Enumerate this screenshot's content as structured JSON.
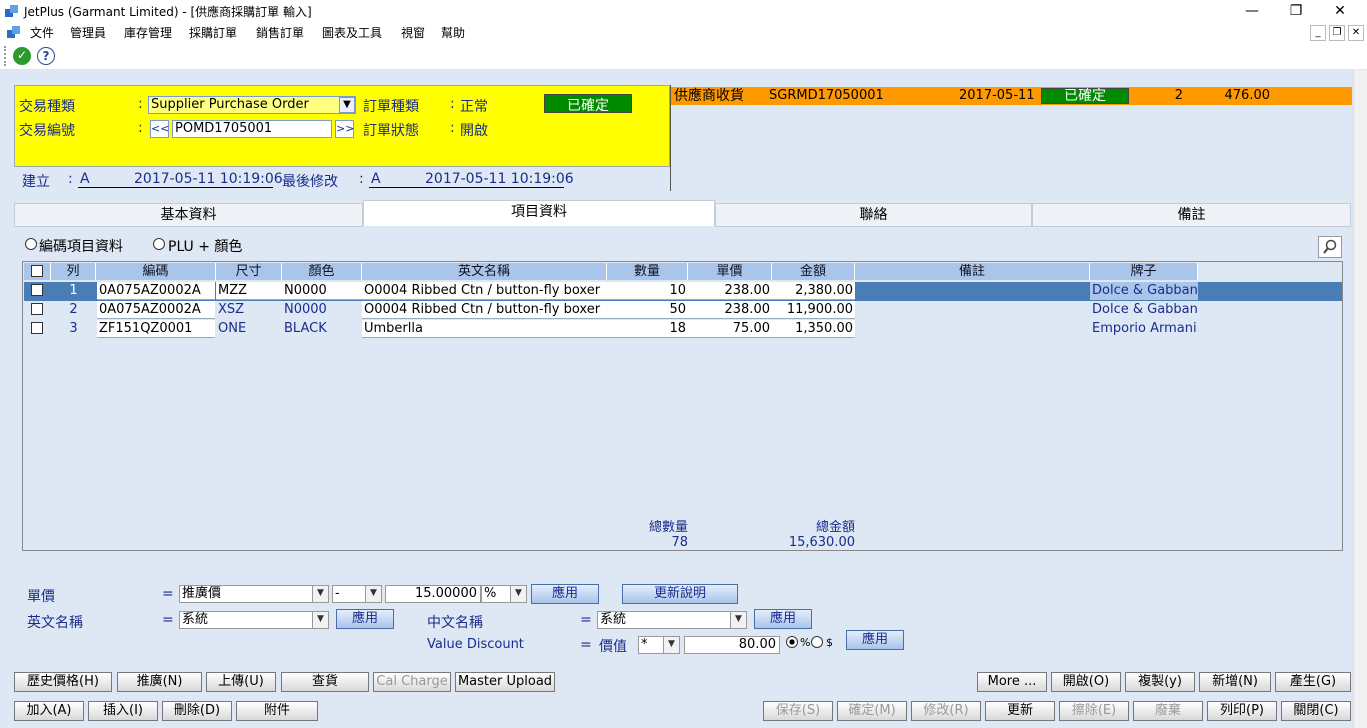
{
  "window": {
    "title": "JetPlus (Garmant Limited) - [供應商採購訂單 輸入]",
    "min": "—",
    "restore": "❐",
    "close": "✕"
  },
  "menu": [
    "文件",
    "管理員",
    "庫存管理",
    "採購訂單",
    "銷售訂單",
    "圖表及工具",
    "視窗",
    "幫助"
  ],
  "mdi": {
    "min": "_",
    "restore": "❐",
    "close": "✕"
  },
  "header": {
    "trans_type_label": "交易種類",
    "trans_type_value": "Supplier Purchase Order",
    "trans_no_label": "交易編號",
    "trans_no_value": "POMD1705001",
    "prev": "<<",
    "next": ">>",
    "order_type_label": "訂單種類",
    "order_type_value": "正常",
    "order_status_label": "訂單狀態",
    "order_status_value": "開啟",
    "confirmed_badge": "已確定",
    "colon": ":",
    "created_label": "建立",
    "created_by": "A",
    "created_at": "2017-05-11 10:19:06",
    "modified_label": "最後修改",
    "modified_by": "A",
    "modified_at": "2017-05-11 10:19:06"
  },
  "receipt": {
    "label": "供應商收貨",
    "code": "SGRMD17050001",
    "date": "2017-05-11",
    "status": "已確定",
    "qty": "2",
    "amount": "476.00"
  },
  "tabs": [
    "基本資料",
    "項目資料",
    "聯絡",
    "備註"
  ],
  "view": {
    "option1": "編碼項目資料",
    "option2": "PLU + 顏色"
  },
  "grid": {
    "columns": [
      "列",
      "編碼",
      "尺寸",
      "顏色",
      "英文名稱",
      "數量",
      "單價",
      "金額",
      "備註",
      "牌子"
    ],
    "rows": [
      {
        "no": "1",
        "code": "0A075AZ0002A",
        "size": "MZZ",
        "color": "N0000",
        "name": "O0004   Ribbed Ctn / button-fly boxer",
        "qty": "10",
        "price": "238.00",
        "amount": "2,380.00",
        "remark": "",
        "brand": "Dolce & Gabbana"
      },
      {
        "no": "2",
        "code": "0A075AZ0002A",
        "size": "XSZ",
        "color": "N0000",
        "name": "O0004   Ribbed Ctn / button-fly boxer",
        "qty": "50",
        "price": "238.00",
        "amount": "11,900.00",
        "remark": "",
        "brand": "Dolce & Gabbana"
      },
      {
        "no": "3",
        "code": "ZF151QZ0001",
        "size": "ONE",
        "color": "BLACK",
        "name": "Umberlla",
        "qty": "18",
        "price": "75.00",
        "amount": "1,350.00",
        "remark": "",
        "brand": "Emporio Armani"
      }
    ],
    "total_qty_label": "總數量",
    "total_qty": "78",
    "total_amount_label": "總金額",
    "total_amount": "15,630.00"
  },
  "bottom": {
    "eq": "=",
    "price_label": "單價",
    "price_select": "推廣價",
    "price_op": "-",
    "price_value": "15.00000",
    "price_unit": "%",
    "apply": "應用",
    "update_desc": "更新說明",
    "en_name_label": "英文名稱",
    "en_name_select": "系統",
    "cn_name_label": "中文名稱",
    "cn_name_select": "系統",
    "value_discount_label": "Value Discount",
    "value_label": "價值",
    "value_op": "*",
    "value_amount": "80.00",
    "pct": "%",
    "dollar": "$"
  },
  "buttons_row1_left": [
    "歷史價格(H)",
    "推廣(N)",
    "上傳(U)",
    "查貨",
    "Cal Charge",
    "Master Upload"
  ],
  "buttons_row1_right": [
    "More ...",
    "開啟(O)",
    "複製(y)",
    "新增(N)",
    "產生(G)"
  ],
  "buttons_row2_left": [
    "加入(A)",
    "插入(I)",
    "刪除(D)",
    "附件"
  ],
  "buttons_row2_right": [
    "保存(S)",
    "確定(M)",
    "修改(R)",
    "更新",
    "擦除(E)",
    "廢棄",
    "列印(P)",
    "關閉(C)"
  ],
  "colors": {
    "yellow": "#ffff00",
    "orange": "#ff9900",
    "green": "#008a00",
    "selected_row": "#4a7db5",
    "header": "#a9c6ea",
    "background": "#dde8f4"
  }
}
